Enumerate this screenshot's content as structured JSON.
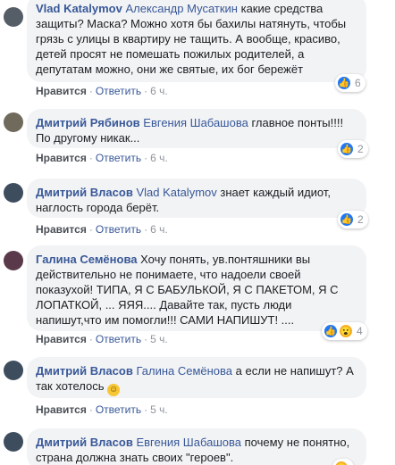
{
  "comments": [
    {
      "author": "Vlad Katalymov",
      "mention": "Александр Мусаткин",
      "text": "какие средства защиты? Маска? Можно хотя бы бахилы натянуть, чтобы грязь с улицы в квартиру не тащить. А вообще, красиво, детей просят не помешать пожилых родителей, а депутатам можно, они же святые, их бог бережёт",
      "like_label": "Нравится",
      "reply_label": "Ответить",
      "time": "6 ч.",
      "reaction_count": "6"
    },
    {
      "author": "Дмитрий Рябинов",
      "mention": "Евгения Шабашова",
      "text": "главное понты!!!!По другому никак...",
      "like_label": "Нравится",
      "reply_label": "Ответить",
      "time": "6 ч.",
      "reaction_count": "2"
    },
    {
      "author": "Дмитрий Власов",
      "mention": "Vlad Katalymov",
      "text": "знает каждый идиот, наглость города берёт.",
      "like_label": "Нравится",
      "reply_label": "Ответить",
      "time": "6 ч.",
      "reaction_count": "2"
    },
    {
      "author": "Галина Семёнова",
      "mention": "",
      "text": "Хочу понять, ув.понтяшники вы действительно не понимаете, что надоели своей показухой! ТИПА, Я С БАБУЛЬКОЙ, Я С ПАКЕТОМ, Я С ЛОПАТКОЙ, ... ЯЯЯ.... Давайте так, пусть люди напишут,что им помогли!!! САМИ НАПИШУТ! ....",
      "like_label": "Нравится",
      "reply_label": "Ответить",
      "time": "5 ч.",
      "reaction_count": "4"
    },
    {
      "author": "Дмитрий Власов",
      "mention": "Галина Семёнова",
      "text": "а если не напишут? А так хотелось",
      "like_label": "Нравится",
      "reply_label": "Ответить",
      "time": "5 ч.",
      "reaction_count": ""
    },
    {
      "author": "Дмитрий Власов",
      "mention": "Евгения Шабашова",
      "text": "почему не понятно, страна должна знать своих \"героев\".",
      "like_label": "",
      "reply_label": "",
      "time": "",
      "reaction_count": ""
    }
  ],
  "colors": {
    "link": "#385898",
    "bubble": "#f2f3f5",
    "like": "#2078f4"
  }
}
